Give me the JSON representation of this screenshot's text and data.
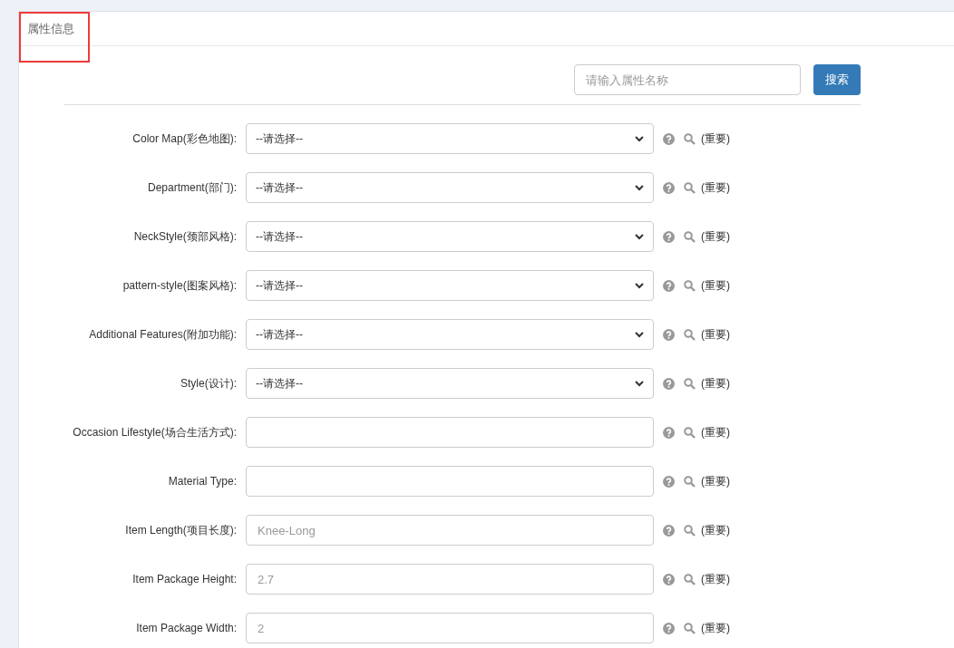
{
  "panel": {
    "title": "属性信息"
  },
  "search": {
    "placeholder": "请输入属性名称",
    "button": "搜索"
  },
  "fields": [
    {
      "label": "Color Map(彩色地图):",
      "kind": "select",
      "value": "--请选择--",
      "note": "(重要)"
    },
    {
      "label": "Department(部门):",
      "kind": "select",
      "value": "--请选择--",
      "note": "(重要)"
    },
    {
      "label": "NeckStyle(颈部风格):",
      "kind": "select",
      "value": "--请选择--",
      "note": "(重要)"
    },
    {
      "label": "pattern-style(图案风格):",
      "kind": "select",
      "value": "--请选择--",
      "note": "(重要)"
    },
    {
      "label": "Additional Features(附加功能):",
      "kind": "select",
      "value": "--请选择--",
      "note": "(重要)"
    },
    {
      "label": "Style(设计):",
      "kind": "select",
      "value": "--请选择--",
      "note": "(重要)"
    },
    {
      "label": "Occasion Lifestyle(场合生活方式):",
      "kind": "input",
      "note": "(重要)"
    },
    {
      "label": "Material Type:",
      "kind": "input",
      "note": "(重要)"
    },
    {
      "label": "Item Length(项目长度):",
      "kind": "input",
      "placeholder": "Knee-Long",
      "note": "(重要)"
    },
    {
      "label": "Item Package Height:",
      "kind": "input",
      "placeholder": "2.7",
      "note": "(重要)"
    },
    {
      "label": "Item Package Width:",
      "kind": "input",
      "placeholder": "2",
      "note": "(重要)"
    }
  ]
}
